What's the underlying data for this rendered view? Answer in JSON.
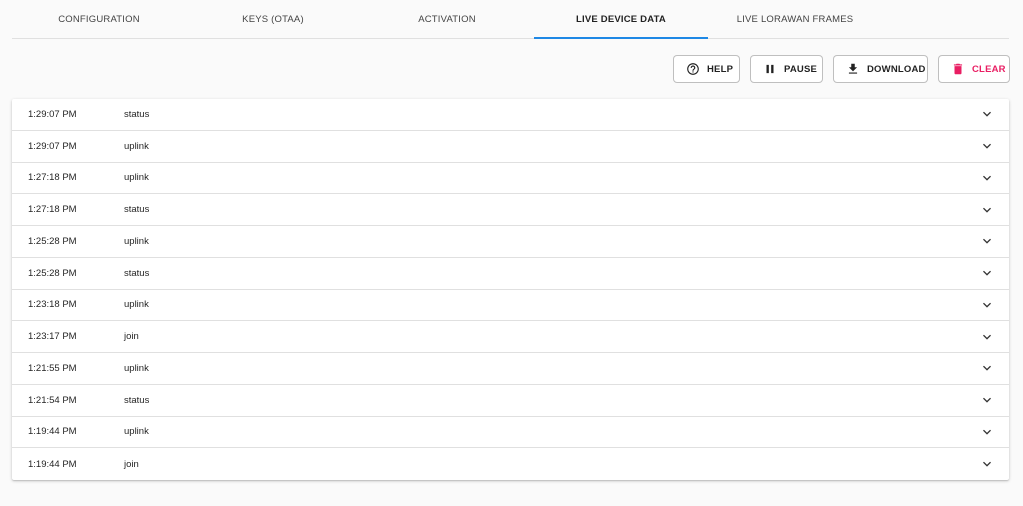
{
  "tabs": [
    {
      "label": "CONFIGURATION"
    },
    {
      "label": "KEYS (OTAA)"
    },
    {
      "label": "ACTIVATION"
    },
    {
      "label": "LIVE DEVICE DATA"
    },
    {
      "label": "LIVE LORAWAN FRAMES"
    }
  ],
  "toolbar": {
    "help_label": "HELP",
    "pause_label": "PAUSE",
    "download_label": "DOWNLOAD",
    "clear_label": "CLEAR"
  },
  "colors": {
    "accent": "#1e88e5",
    "clear": "#e91e63"
  },
  "events": [
    {
      "time": "1:29:07 PM",
      "type": "status"
    },
    {
      "time": "1:29:07 PM",
      "type": "uplink"
    },
    {
      "time": "1:27:18 PM",
      "type": "uplink"
    },
    {
      "time": "1:27:18 PM",
      "type": "status"
    },
    {
      "time": "1:25:28 PM",
      "type": "uplink"
    },
    {
      "time": "1:25:28 PM",
      "type": "status"
    },
    {
      "time": "1:23:18 PM",
      "type": "uplink"
    },
    {
      "time": "1:23:17 PM",
      "type": "join"
    },
    {
      "time": "1:21:55 PM",
      "type": "uplink"
    },
    {
      "time": "1:21:54 PM",
      "type": "status"
    },
    {
      "time": "1:19:44 PM",
      "type": "uplink"
    },
    {
      "time": "1:19:44 PM",
      "type": "join"
    }
  ]
}
